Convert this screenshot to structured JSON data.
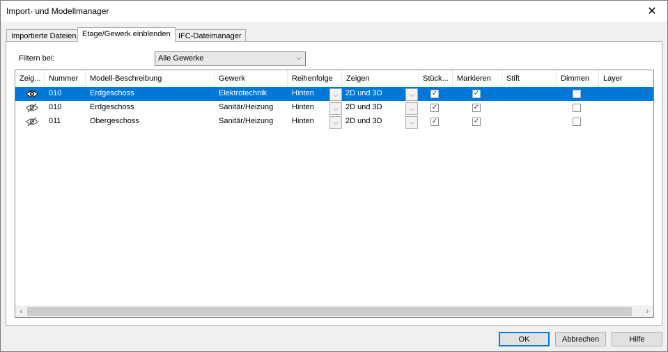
{
  "window": {
    "title": "Import- und Modellmanager",
    "close_glyph": "✕"
  },
  "tabs": [
    {
      "label": "Importierte Dateien",
      "active": false
    },
    {
      "label": "Etage/Gewerk einblenden",
      "active": true
    },
    {
      "label": "IFC-Dateimanager",
      "active": false
    }
  ],
  "filter": {
    "label": "Filtern bei:",
    "value": "Alle Gewerke",
    "chevron_glyph": "⌵"
  },
  "grid": {
    "columns": [
      "Zeig...",
      "Nummer",
      "Modell-Beschreibung",
      "Gewerk",
      "Reihenfolge",
      "Zeigen",
      "Stück...",
      "Markieren",
      "Stift",
      "Dimmen",
      "Layer"
    ],
    "rows": [
      {
        "visible": true,
        "nummer": "010",
        "beschreibung": "Erdgeschoss",
        "gewerk": "Elektrotechnik",
        "reihenfolge": "Hinten",
        "zeigen": "2D und 3D",
        "stueck": true,
        "markieren": true,
        "stift": "",
        "dimmen": false,
        "layer": "",
        "selected": true
      },
      {
        "visible": false,
        "nummer": "010",
        "beschreibung": "Erdgeschoss",
        "gewerk": "Sanitär/Heizung",
        "reihenfolge": "Hinten",
        "zeigen": "2D und 3D",
        "stueck": true,
        "markieren": true,
        "stift": "",
        "dimmen": false,
        "layer": "",
        "selected": false
      },
      {
        "visible": false,
        "nummer": "011",
        "beschreibung": "Obergeschoss",
        "gewerk": "Sanitär/Heizung",
        "reihenfolge": "Hinten",
        "zeigen": "2D und 3D",
        "stueck": true,
        "markieren": true,
        "stift": "",
        "dimmen": false,
        "layer": "",
        "selected": false
      }
    ],
    "dropdown_glyph": "⌵",
    "check_glyph": "✓",
    "scroll_left_glyph": "‹",
    "scroll_right_glyph": "›"
  },
  "icons": {
    "visible": "eye-icon",
    "hidden": "eye-slash-icon"
  },
  "buttons": {
    "ok": "OK",
    "cancel": "Abbrechen",
    "help": "Hilfe"
  },
  "colors": {
    "selection": "#0078d7",
    "default_button_border": "#0078d7"
  }
}
